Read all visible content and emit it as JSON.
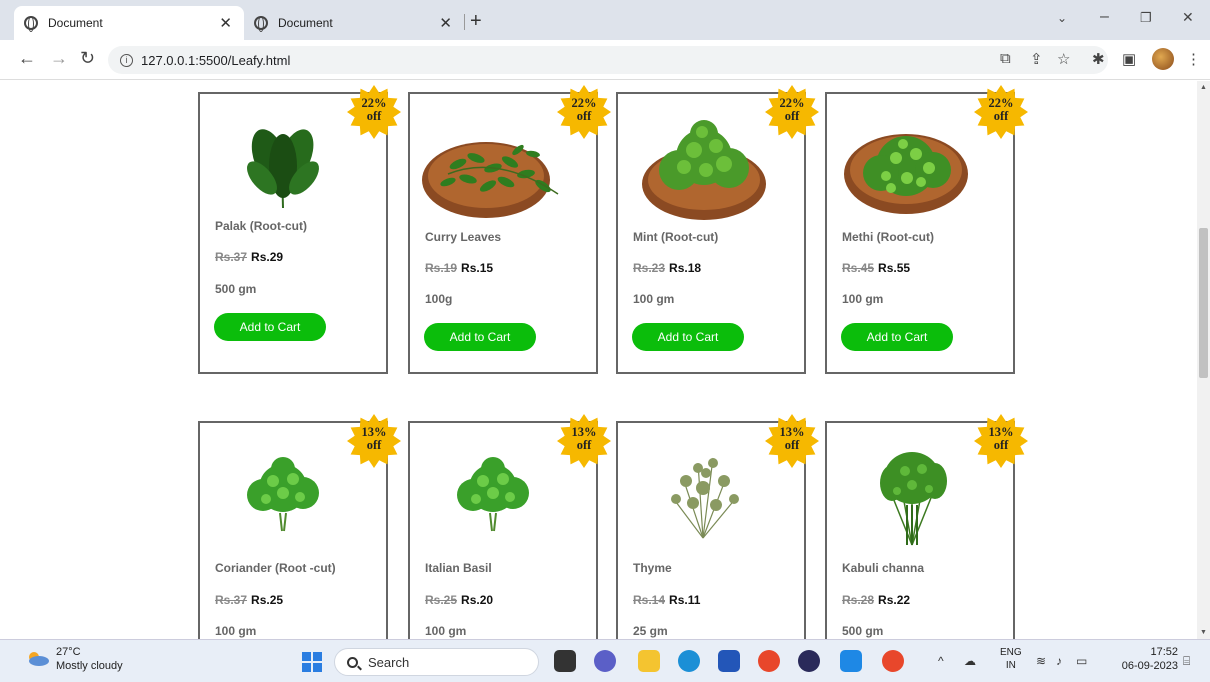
{
  "browser": {
    "tabs": [
      {
        "title": "Document",
        "active": true
      },
      {
        "title": "Document",
        "active": false
      }
    ],
    "url": "127.0.0.1:5500/Leafy.html"
  },
  "products_row1": [
    {
      "name": "Palak (Root-cut)",
      "old_price": "Rs.37",
      "price": "Rs.29",
      "qty": "500 gm",
      "discount": "22%",
      "off": "off",
      "button": "Add to Cart"
    },
    {
      "name": "Curry Leaves",
      "old_price": "Rs.19",
      "price": "Rs.15",
      "qty": "100g",
      "discount": "22%",
      "off": "off",
      "button": "Add to Cart"
    },
    {
      "name": "Mint (Root-cut)",
      "old_price": "Rs.23",
      "price": "Rs.18",
      "qty": "100 gm",
      "discount": "22%",
      "off": "off",
      "button": "Add to Cart"
    },
    {
      "name": "Methi (Root-cut)",
      "old_price": "Rs.45",
      "price": "Rs.55",
      "qty": "100 gm",
      "discount": "22%",
      "off": "off",
      "button": "Add to Cart"
    }
  ],
  "products_row2": [
    {
      "name": "Coriander (Root -cut)",
      "old_price": "Rs.37",
      "price": "Rs.25",
      "qty": "100 gm",
      "discount": "13%",
      "off": "off"
    },
    {
      "name": "Italian Basil",
      "old_price": "Rs.25",
      "price": "Rs.20",
      "qty": "100 gm",
      "discount": "13%",
      "off": "off"
    },
    {
      "name": "Thyme",
      "old_price": "Rs.14",
      "price": "Rs.11",
      "qty": "25 gm",
      "discount": "13%",
      "off": "off"
    },
    {
      "name": "Kabuli channa",
      "old_price": "Rs.28",
      "price": "Rs.22",
      "qty": "500 gm",
      "discount": "13%",
      "off": "off"
    }
  ],
  "taskbar": {
    "weather_temp": "27°C",
    "weather_desc": "Mostly cloudy",
    "search_placeholder": "Search",
    "lang_line1": "ENG",
    "lang_line2": "IN",
    "time": "17:52",
    "date": "06-09-2023"
  },
  "colors": {
    "accent_button": "#0bbd0b",
    "badge": "#f6b800",
    "card_border": "#666666"
  }
}
